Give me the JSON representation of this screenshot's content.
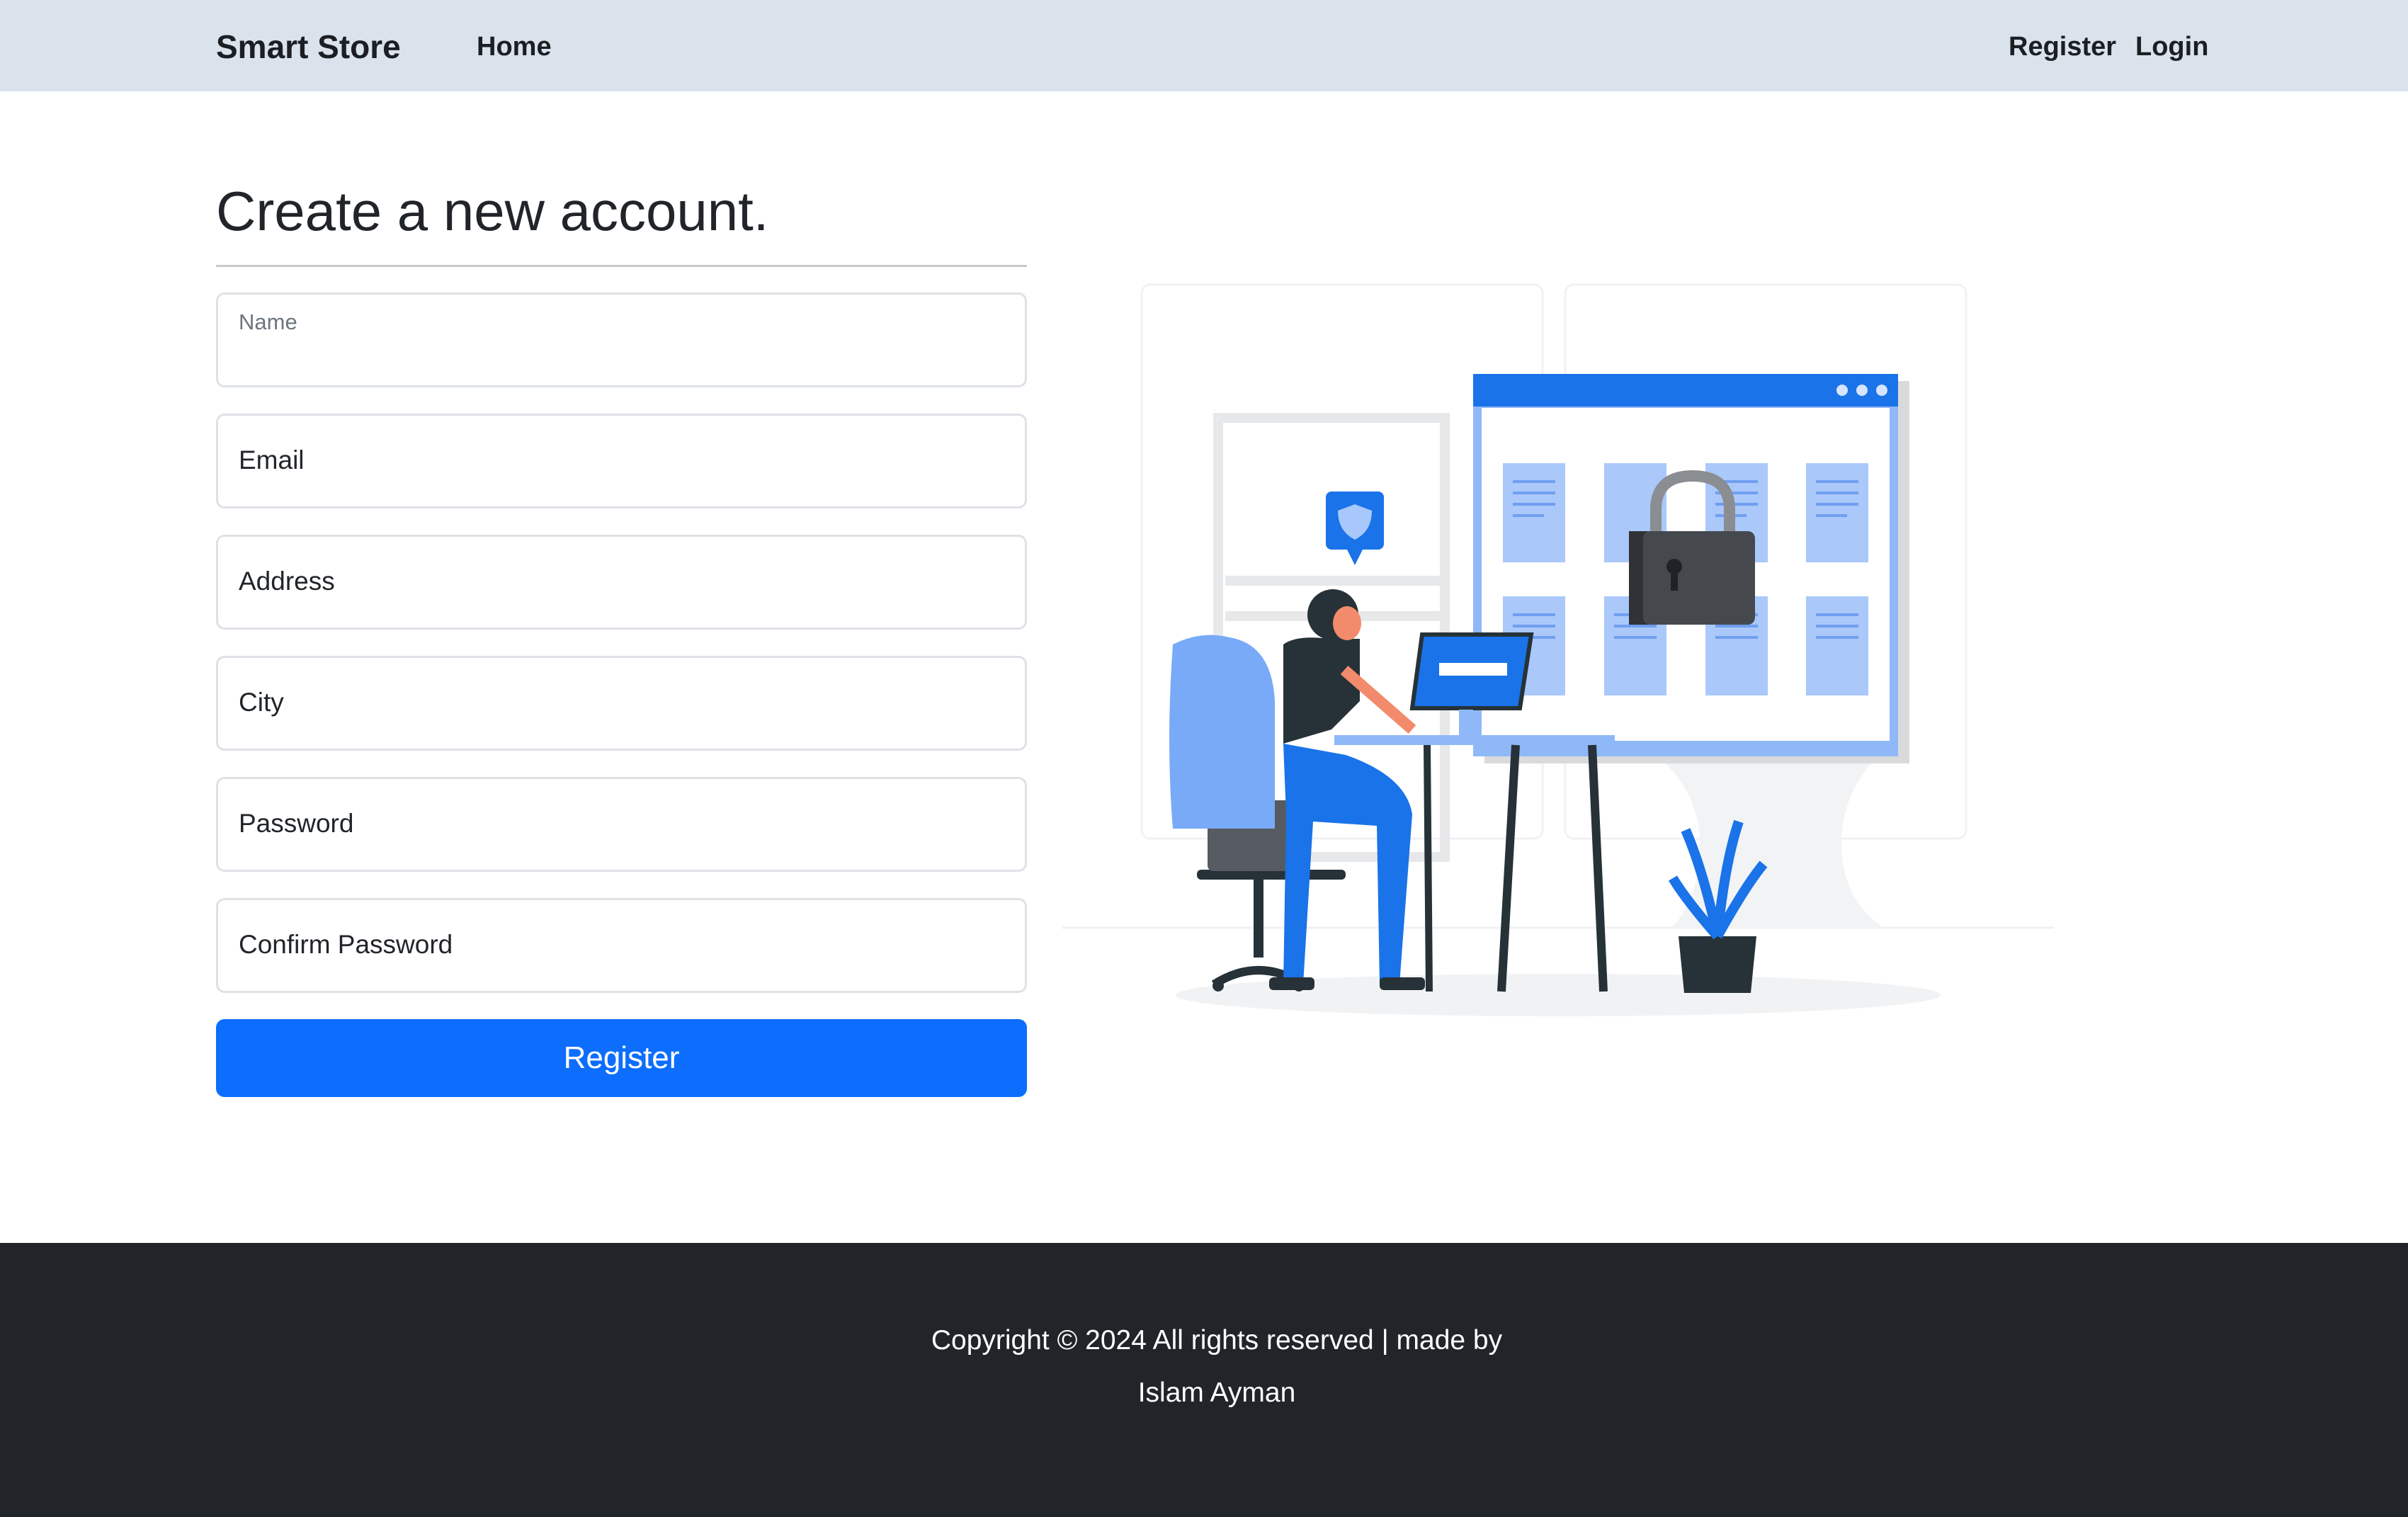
{
  "navbar": {
    "brand": "Smart Store",
    "home_label": "Home",
    "register_label": "Register",
    "login_label": "Login"
  },
  "main": {
    "heading": "Create a new account.",
    "fields": {
      "name": "Name",
      "email": "Email",
      "address": "Address",
      "city": "City",
      "password": "Password",
      "confirm_password": "Confirm Password"
    },
    "submit_label": "Register"
  },
  "footer": {
    "copyright": "Copyright © 2024 All rights reserved | made by",
    "author": "Islam Ayman"
  },
  "colors": {
    "navbar_bg": "#dae3eb",
    "primary": "#0d6efd",
    "footer_bg": "#212529"
  }
}
